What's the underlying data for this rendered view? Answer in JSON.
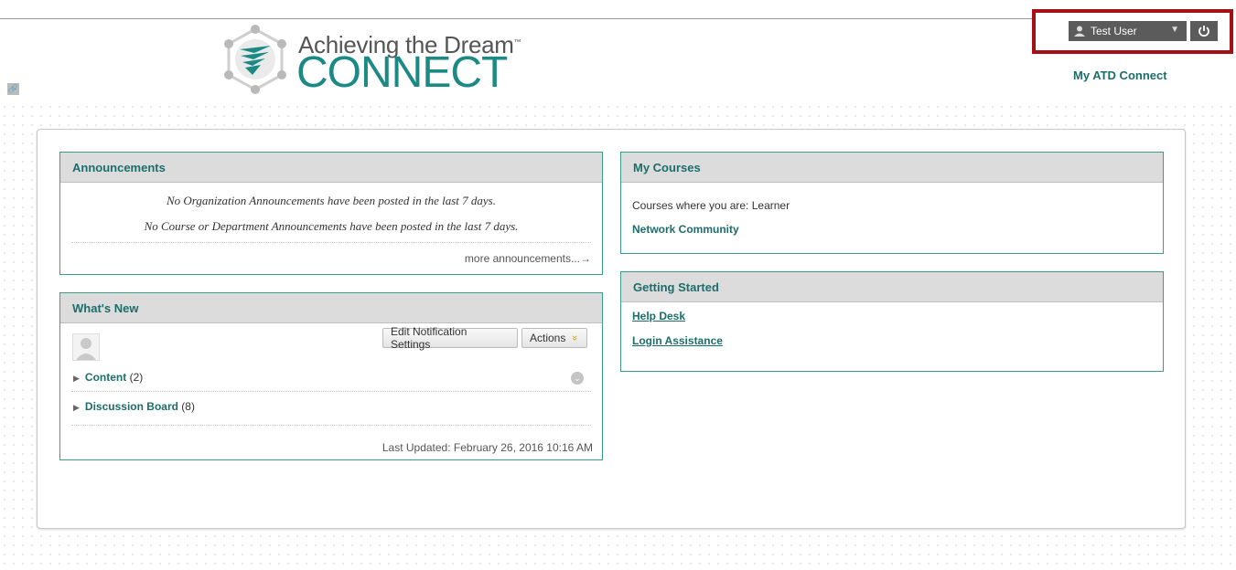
{
  "logo": {
    "line1": "Achieving the Dream",
    "tm": "™",
    "line2": "CONNECT"
  },
  "header": {
    "link_badge": "🔗",
    "user_name": "Test User",
    "user_caret": "▼",
    "power_glyph": "⏻",
    "my_atd_link": "My ATD Connect"
  },
  "announcements": {
    "title": "Announcements",
    "line1": "No Organization Announcements have been posted in the last 7 days.",
    "line2": "No Course or Department Announcements have been posted in the last 7 days.",
    "more": "more announcements...→"
  },
  "whats_new": {
    "title": "What's New",
    "edit_button": "Edit Notification Settings",
    "actions_button": "Actions",
    "actions_chevron": "»",
    "items": [
      {
        "label": "Content",
        "count": "(2)"
      },
      {
        "label": "Discussion Board",
        "count": "(8)"
      }
    ],
    "last_updated": "Last Updated: February 26, 2016 10:16 AM"
  },
  "my_courses": {
    "title": "My Courses",
    "role_text": "Courses where you are: Learner",
    "course": "Network Community"
  },
  "getting_started": {
    "title": "Getting Started",
    "links": [
      "Help Desk",
      "Login Assistance"
    ]
  },
  "colors": {
    "accent_teal": "#1b6e6a",
    "highlight_red": "#a50f16"
  }
}
